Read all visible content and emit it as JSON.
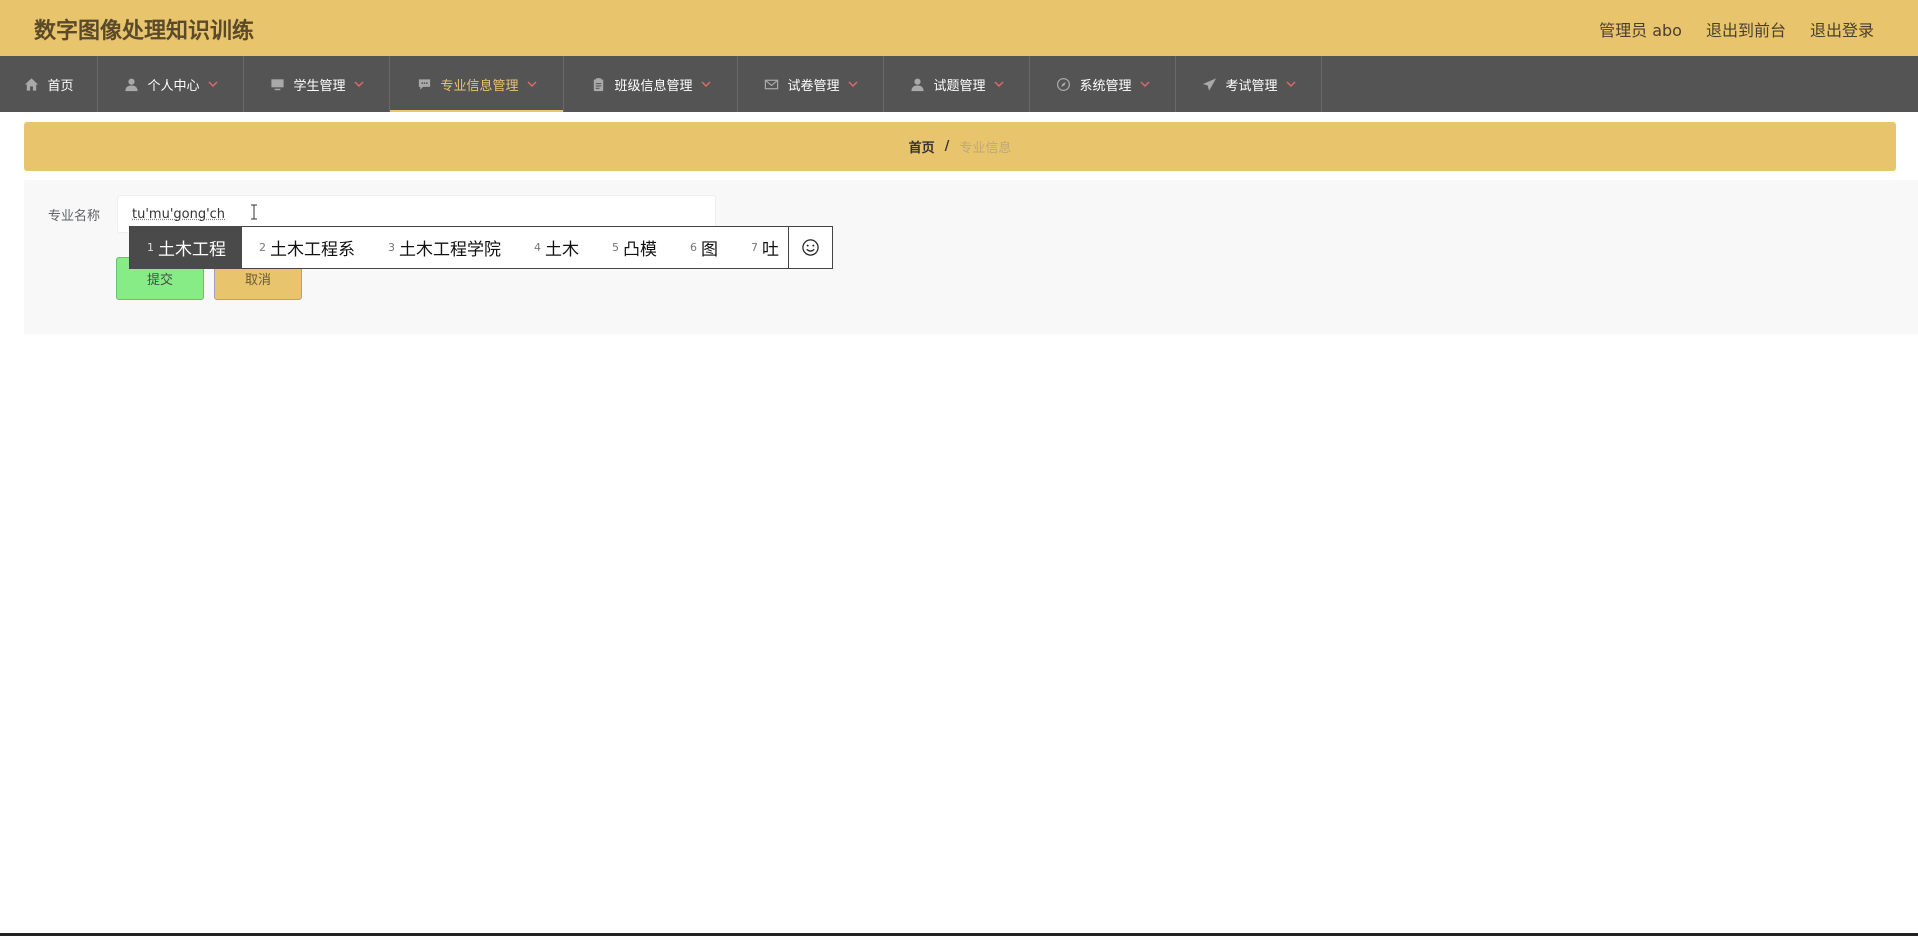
{
  "header": {
    "title": "数字图像处理知识训练",
    "links": [
      "管理员 abo",
      "退出到前台",
      "退出登录"
    ],
    "bg_color": "#e8c46d"
  },
  "nav": {
    "items": [
      {
        "label": "首页",
        "icon": "home-icon",
        "has_dropdown": false,
        "active": false
      },
      {
        "label": "个人中心",
        "icon": "user-icon",
        "has_dropdown": true,
        "active": false
      },
      {
        "label": "学生管理",
        "icon": "monitor-icon",
        "has_dropdown": true,
        "active": false
      },
      {
        "label": "专业信息管理",
        "icon": "chat-icon",
        "has_dropdown": true,
        "active": true
      },
      {
        "label": "班级信息管理",
        "icon": "clipboard-icon",
        "has_dropdown": true,
        "active": false
      },
      {
        "label": "试卷管理",
        "icon": "mail-icon",
        "has_dropdown": true,
        "active": false
      },
      {
        "label": "试题管理",
        "icon": "user-icon",
        "has_dropdown": true,
        "active": false
      },
      {
        "label": "系统管理",
        "icon": "compass-icon",
        "has_dropdown": true,
        "active": false
      },
      {
        "label": "考试管理",
        "icon": "send-icon",
        "has_dropdown": true,
        "active": false
      }
    ],
    "bg_color": "#555454",
    "active_color": "#e8c46d"
  },
  "breadcrumb": {
    "home": "首页",
    "separator": "/",
    "current": "专业信息"
  },
  "form": {
    "field_label": "专业名称",
    "field_value": "tu'mu'gong'ch",
    "submit_label": "提交",
    "cancel_label": "取消"
  },
  "ime": {
    "candidates": [
      {
        "num": "1",
        "text": "土木工程"
      },
      {
        "num": "2",
        "text": "土木工程系"
      },
      {
        "num": "3",
        "text": "土木工程学院"
      },
      {
        "num": "4",
        "text": "土木"
      },
      {
        "num": "5",
        "text": "凸模"
      },
      {
        "num": "6",
        "text": "图"
      },
      {
        "num": "7",
        "text": "吐"
      }
    ],
    "selected_index": 0,
    "extra_icon": "smiley-icon"
  }
}
